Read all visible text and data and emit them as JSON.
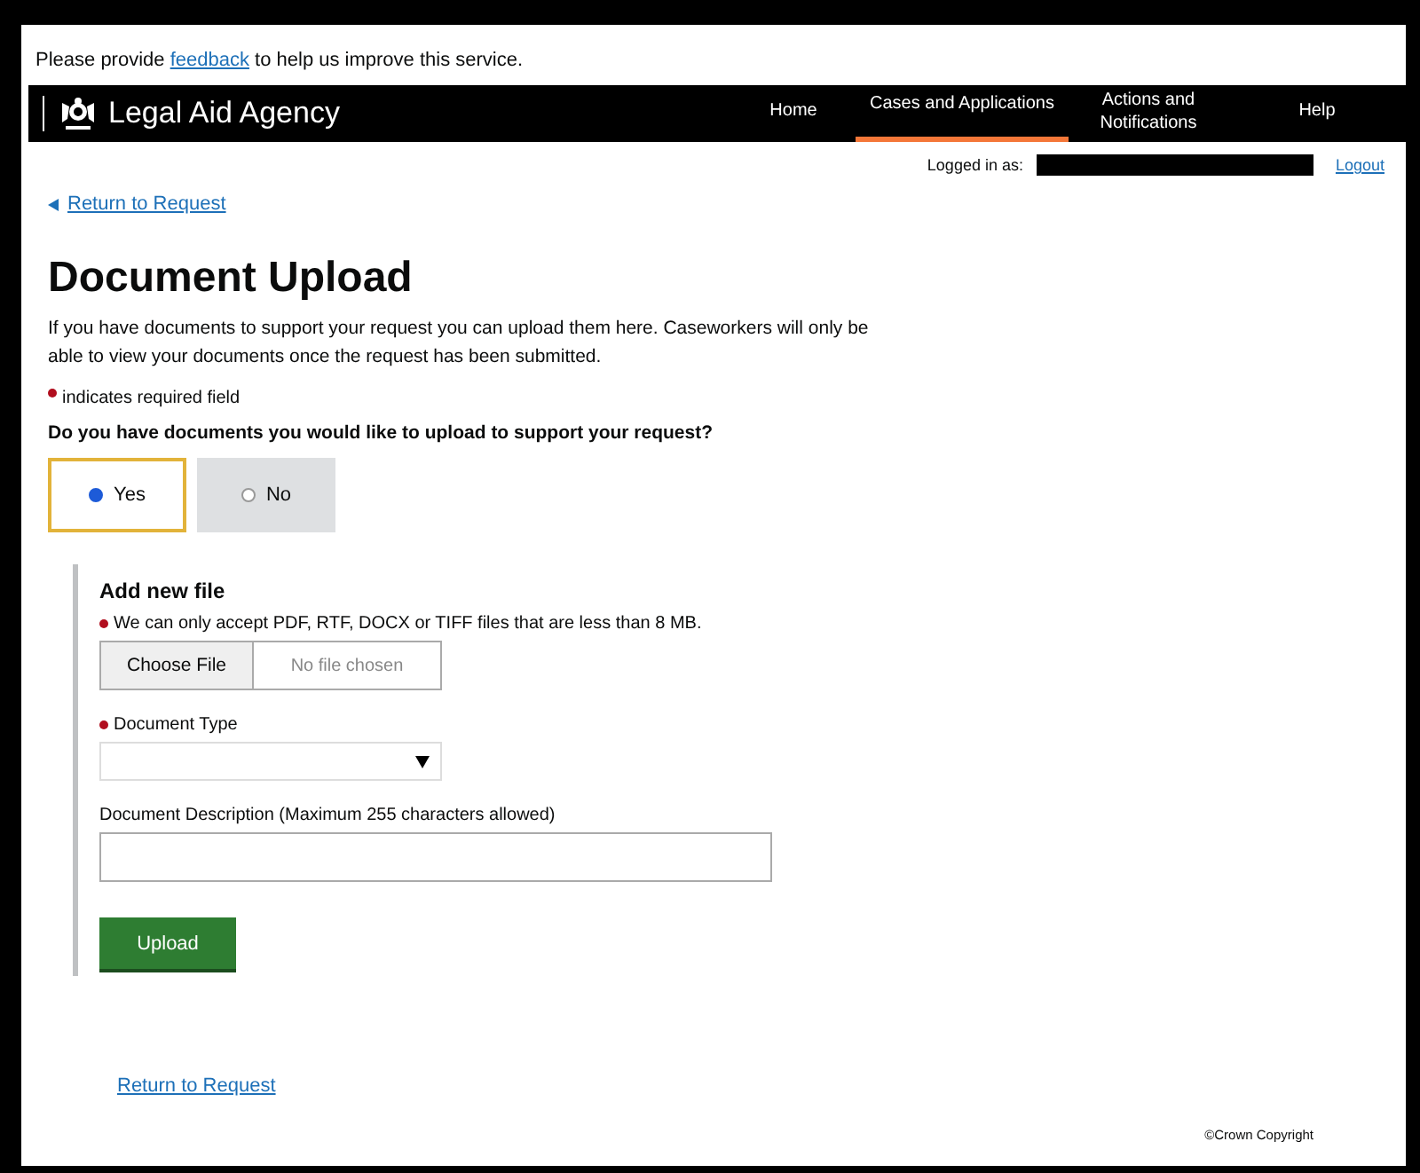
{
  "feedback_banner": {
    "before": "Please provide",
    "link": "feedback",
    "after": "to help us improve this service."
  },
  "header": {
    "brand": "Legal Aid Agency",
    "nav": [
      {
        "label": "Home",
        "selected": false
      },
      {
        "label": "Cases and Applications",
        "selected": true
      },
      {
        "label": "Actions and Notifications",
        "selected": false
      },
      {
        "label": "Help",
        "selected": false
      }
    ]
  },
  "account": {
    "label": "Logged in as:",
    "logout": "Logout"
  },
  "back_link": "Return to Request",
  "title": "Document Upload",
  "intro": "If you have documents to support your request you can upload them here. Caseworkers will only be able to view your documents once the request has been submitted.",
  "required_note": "indicates required field",
  "question": "Do you have documents you would like to upload to support your request?",
  "options": [
    {
      "label": "Yes",
      "selected": true
    },
    {
      "label": "No",
      "selected": false
    }
  ],
  "upload_panel": {
    "heading": "Add new file",
    "fields": [
      {
        "kind": "file",
        "label": "We can only accept PDF, RTF, DOCX or TIFF files that are less than 8 MB.",
        "required": true,
        "button": "Choose File",
        "status": "No file chosen"
      },
      {
        "kind": "select",
        "label": "Document Type",
        "required": true
      },
      {
        "kind": "text",
        "label": "Document Description (Maximum 255 characters allowed)",
        "required": false
      }
    ],
    "button": "Upload"
  },
  "footer_link": "Return to Request",
  "copyright": "©Crown Copyright"
}
